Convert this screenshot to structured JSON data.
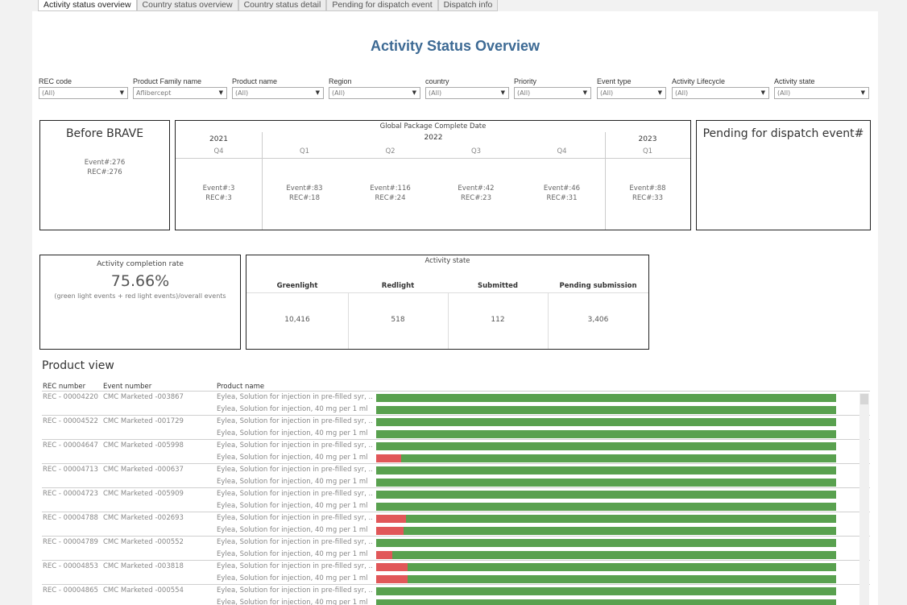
{
  "tabs": [
    "Activity status overview",
    "Country status overview",
    "Country status detail",
    "Pending for dispatch event",
    "Dispatch info"
  ],
  "title": "Activity Status Overview",
  "filters": [
    {
      "label": "REC code",
      "value": "(All)"
    },
    {
      "label": "Product Family name",
      "value": "Aflibercept"
    },
    {
      "label": "Product name",
      "value": "(All)"
    },
    {
      "label": "Region",
      "value": "(All)"
    },
    {
      "label": "country",
      "value": "(All)"
    },
    {
      "label": "Priority",
      "value": "(All)"
    },
    {
      "label": "Event type",
      "value": "(All)"
    },
    {
      "label": "Activity Lifecycle",
      "value": "(All)"
    },
    {
      "label": "Activity state",
      "value": "(All)"
    }
  ],
  "before_brave": {
    "title": "Before BRAVE",
    "event": "Event#:276",
    "rec": "REC#:276"
  },
  "global_package": {
    "header": "Global Package Complete Date",
    "years": [
      "2021",
      "2022",
      "2023"
    ],
    "quarters": [
      "Q4",
      "Q1",
      "Q2",
      "Q3",
      "Q4",
      "Q1"
    ],
    "cells": [
      {
        "event": "Event#:3",
        "rec": "REC#:3"
      },
      {
        "event": "Event#:83",
        "rec": "REC#:18"
      },
      {
        "event": "Event#:116",
        "rec": "REC#:24"
      },
      {
        "event": "Event#:42",
        "rec": "REC#:23"
      },
      {
        "event": "Event#:46",
        "rec": "REC#:31"
      },
      {
        "event": "Event#:88",
        "rec": "REC#:33"
      }
    ]
  },
  "pending": {
    "title": "Pending for dispatch event#"
  },
  "completion": {
    "title": "Activity completion rate",
    "value": "75.66%",
    "note": "(green light events + red light events)/overall events"
  },
  "activity_state": {
    "title": "Activity state",
    "columns": [
      "Greenlight",
      "Redlight",
      "Submitted",
      "Pending submission"
    ],
    "values": [
      "10,416",
      "518",
      "112",
      "3,406"
    ]
  },
  "product_view": {
    "title": "Product view",
    "headers": {
      "rec": "REC number",
      "event": "Event number",
      "product": "Product name"
    },
    "product_a": "Eylea, Solution for injection in pre-filled syr, ..",
    "product_b": "Eylea, Solution for injection, 40 mg per 1 ml",
    "rows": [
      {
        "rec": "REC - 00004220",
        "event": "CMC Marketed -003867",
        "red_a": 0,
        "red_b": 0
      },
      {
        "rec": "REC - 00004522",
        "event": "CMC Marketed -001729",
        "red_a": 0,
        "red_b": 0
      },
      {
        "rec": "REC - 00004647",
        "event": "CMC Marketed -005998",
        "red_a": 0,
        "red_b": 0.055
      },
      {
        "rec": "REC - 00004713",
        "event": "CMC Marketed -000637",
        "red_a": 0,
        "red_b": 0
      },
      {
        "rec": "REC - 00004723",
        "event": "CMC Marketed -005909",
        "red_a": 0,
        "red_b": 0
      },
      {
        "rec": "REC - 00004788",
        "event": "CMC Marketed -002693",
        "red_a": 0.065,
        "red_b": 0.06
      },
      {
        "rec": "REC - 00004789",
        "event": "CMC Marketed -000552",
        "red_a": 0,
        "red_b": 0.035
      },
      {
        "rec": "REC - 00004853",
        "event": "CMC Marketed -003818",
        "red_a": 0.068,
        "red_b": 0.068
      },
      {
        "rec": "REC - 00004865",
        "event": "CMC Marketed -000554",
        "red_a": 0,
        "red_b": 0
      }
    ]
  },
  "colors": {
    "green": "#59a14f",
    "red": "#e15759",
    "title": "#3d6a94"
  }
}
